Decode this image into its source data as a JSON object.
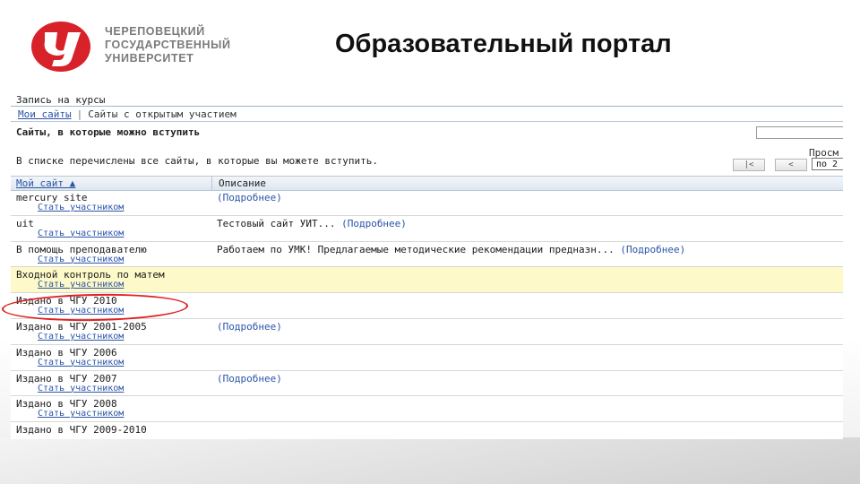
{
  "header": {
    "university_lines": [
      "ЧЕРЕПОВЕЦКИЙ",
      "ГОСУДАРСТВЕННЫЙ",
      "УНИВЕРСИТЕТ"
    ],
    "slide_title": "Образовательный портал",
    "logo_colors": {
      "red": "#d8222a",
      "white": "#ffffff"
    }
  },
  "portlet": {
    "title": "Запись на курсы",
    "tabs": [
      {
        "label": "Мои сайты",
        "active": true
      },
      {
        "label": "Сайты с открытым участием",
        "active": false
      }
    ],
    "section_heading": "Сайты, в которые можно вступить",
    "intro_text": "В списке перечислены все сайты, в которые вы можете вступить.",
    "view_label": "Просм",
    "pager": {
      "first": "|<",
      "prev": "<",
      "select_value": "по 2"
    },
    "columns": {
      "site": "Мой сайт ▲",
      "description": "Описание"
    },
    "join_label": "Стать участником",
    "rows": [
      {
        "name": "mercury site",
        "description": "",
        "more": "(Подробнее)",
        "has_join": true
      },
      {
        "name": "uit",
        "description": "Тестовый сайт УИТ...",
        "more": "(Подробнее)",
        "has_join": true
      },
      {
        "name": "В помощь преподавателю",
        "description": "Работаем по УМК! Предлагаемые методические рекомендации предназн...",
        "more": "(Подробнее)",
        "has_join": true
      },
      {
        "name": "Входной контроль по матем",
        "description": "",
        "more": "",
        "has_join": true,
        "highlight": true
      },
      {
        "name": "Издано в ЧГУ 2010",
        "description": "",
        "more": "",
        "has_join": true
      },
      {
        "name": "Издано в ЧГУ 2001-2005",
        "description": "",
        "more": "(Подробнее)",
        "has_join": true
      },
      {
        "name": "Издано в ЧГУ 2006",
        "description": "",
        "more": "",
        "has_join": true
      },
      {
        "name": "Издано в ЧГУ 2007",
        "description": "",
        "more": "(Подробнее)",
        "has_join": true
      },
      {
        "name": "Издано в ЧГУ 2008",
        "description": "",
        "more": "",
        "has_join": true
      },
      {
        "name": "Издано в ЧГУ 2009-2010",
        "description": "",
        "more": "",
        "has_join": false
      }
    ]
  },
  "annotation": {
    "ring_color": "#e02020"
  }
}
